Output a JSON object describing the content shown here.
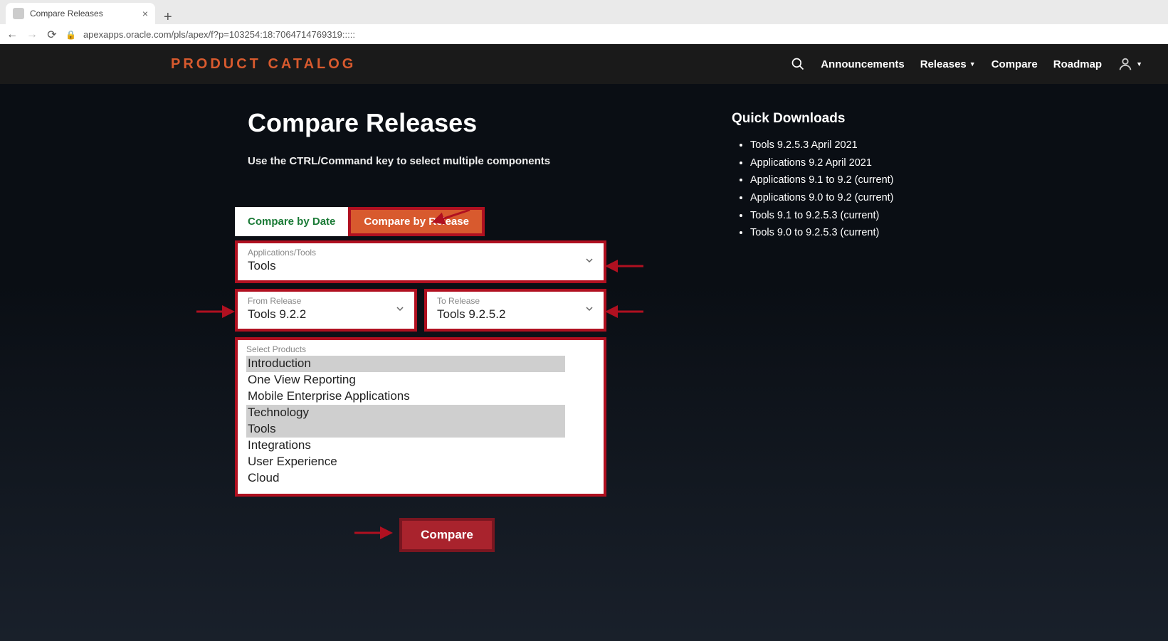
{
  "browser": {
    "tab_title": "Compare Releases",
    "url": "apexapps.oracle.com/pls/apex/f?p=103254:18:7064714769319:::::"
  },
  "topbar": {
    "brand": "PRODUCT CATALOG",
    "nav": {
      "announcements": "Announcements",
      "releases": "Releases",
      "compare": "Compare",
      "roadmap": "Roadmap"
    }
  },
  "page": {
    "title": "Compare Releases",
    "subtext": "Use the CTRL/Command key to select multiple components",
    "tabs": {
      "by_date": "Compare by Date",
      "by_release": "Compare by Release"
    },
    "app_tools": {
      "label": "Applications/Tools",
      "value": "Tools"
    },
    "from_release": {
      "label": "From Release",
      "value": "Tools 9.2.2"
    },
    "to_release": {
      "label": "To Release",
      "value": "Tools 9.2.5.2"
    },
    "products": {
      "label": "Select Products",
      "options": [
        {
          "text": "Introduction",
          "selected": true
        },
        {
          "text": "One View Reporting",
          "selected": false
        },
        {
          "text": "Mobile Enterprise Applications",
          "selected": false
        },
        {
          "text": "Technology",
          "selected": true
        },
        {
          "text": "Tools",
          "selected": true
        },
        {
          "text": "Integrations",
          "selected": false
        },
        {
          "text": "User Experience",
          "selected": false
        },
        {
          "text": "Cloud",
          "selected": false
        }
      ]
    },
    "compare_button": "Compare"
  },
  "sidebar": {
    "title": "Quick Downloads",
    "links": [
      "Tools 9.2.5.3 April 2021",
      "Applications 9.2 April 2021",
      "Applications 9.1 to 9.2 (current)",
      "Applications 9.0 to 9.2 (current)",
      "Tools 9.1 to 9.2.5.3 (current)",
      "Tools 9.0 to 9.2.5.3 (current)"
    ]
  }
}
